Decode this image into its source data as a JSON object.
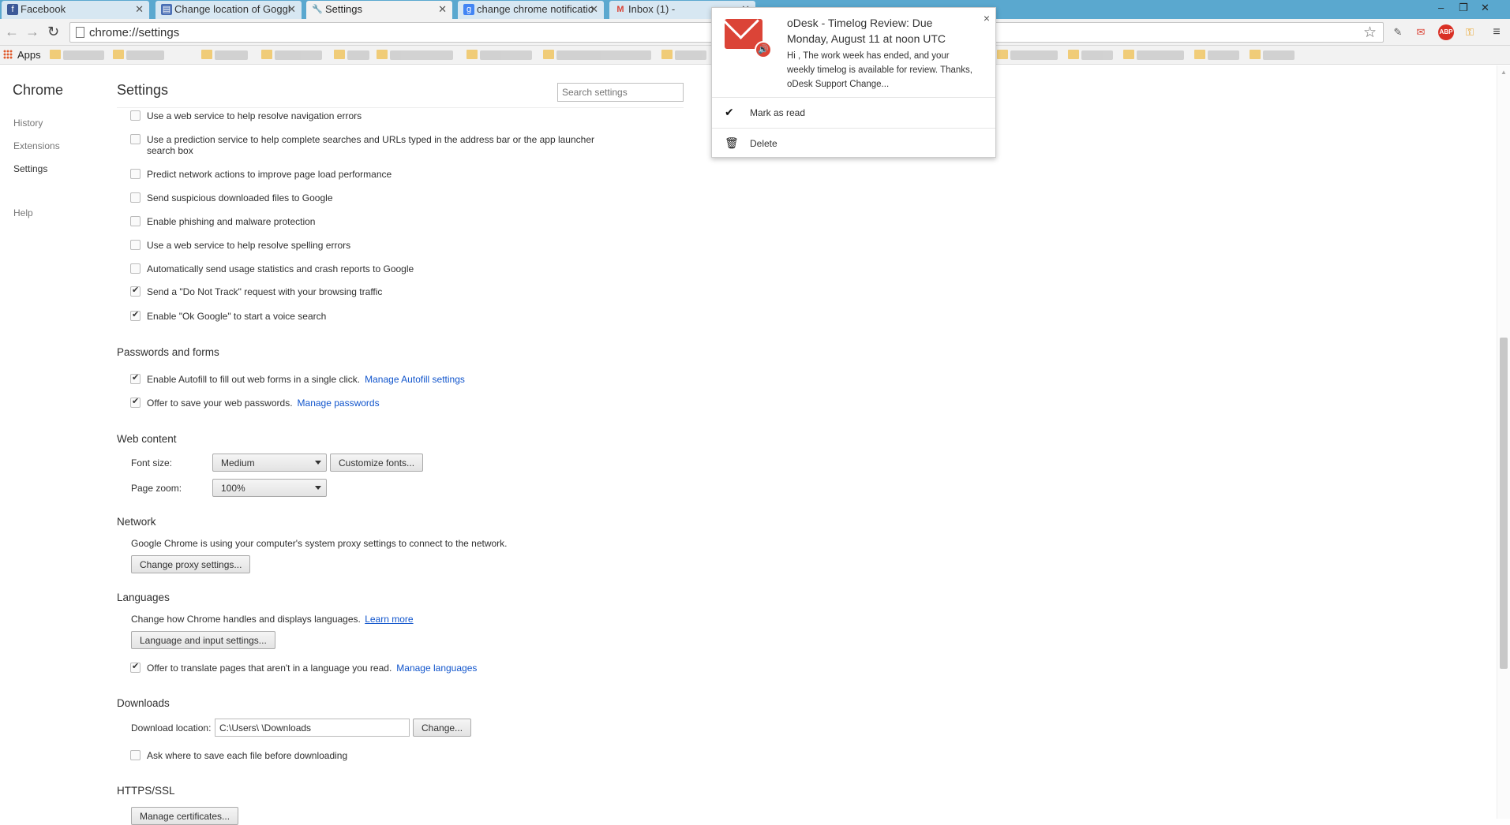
{
  "tabs": [
    {
      "label": "Facebook",
      "icon": "facebook-icon",
      "color": "#3b5998",
      "glyph": "f"
    },
    {
      "label": "Change location of Goggl",
      "icon": "document-icon",
      "color": "#4a6fb5",
      "glyph": "▤"
    },
    {
      "label": "Settings",
      "icon": "wrench-icon",
      "color": "#555555",
      "glyph": "🔧"
    },
    {
      "label": "change chrome notificatio",
      "icon": "google-icon",
      "color": "#4285f4",
      "glyph": "g"
    },
    {
      "label": "Inbox (1) -",
      "icon": "gmail-icon",
      "color": "#db4437",
      "glyph": "M"
    }
  ],
  "window_controls": [
    "–",
    "❐",
    "✕"
  ],
  "omnibox": {
    "url": "chrome://settings"
  },
  "bookmarks": {
    "apps_label": "Apps"
  },
  "sidebar": {
    "title": "Chrome",
    "items": [
      {
        "label": "History"
      },
      {
        "label": "Extensions"
      },
      {
        "label": "Settings"
      },
      {
        "label": "Help"
      }
    ]
  },
  "page": {
    "title": "Settings",
    "search_placeholder": "Search settings"
  },
  "privacy": [
    {
      "label": "Use a web service to help resolve navigation errors",
      "checked": false
    },
    {
      "label": "Use a prediction service to help complete searches and URLs typed in the address bar or the app launcher search box",
      "checked": false
    },
    {
      "label": "Predict network actions to improve page load performance",
      "checked": false
    },
    {
      "label": "Send suspicious downloaded files to Google",
      "checked": false
    },
    {
      "label": "Enable phishing and malware protection",
      "checked": false
    },
    {
      "label": "Use a web service to help resolve spelling errors",
      "checked": false
    },
    {
      "label": "Automatically send usage statistics and crash reports to Google",
      "checked": false
    },
    {
      "label": "Send a \"Do Not Track\" request with your browsing traffic",
      "checked": true
    },
    {
      "label": "Enable \"Ok Google\" to start a voice search",
      "checked": true
    }
  ],
  "passwords": {
    "title": "Passwords and forms",
    "autofill": {
      "label": "Enable Autofill to fill out web forms in a single click.",
      "link": "Manage Autofill settings",
      "checked": true
    },
    "save_pw": {
      "label": "Offer to save your web passwords.",
      "link": "Manage passwords",
      "checked": true
    }
  },
  "web_content": {
    "title": "Web content",
    "font_size_label": "Font size:",
    "font_size_value": "Medium",
    "customize_fonts": "Customize fonts...",
    "page_zoom_label": "Page zoom:",
    "page_zoom_value": "100%"
  },
  "network": {
    "title": "Network",
    "text": "Google Chrome is using your computer's system proxy settings to connect to the network.",
    "button": "Change proxy settings..."
  },
  "languages": {
    "title": "Languages",
    "text": "Change how Chrome handles and displays languages.",
    "learn_more": "Learn more",
    "button": "Language and input settings...",
    "translate": {
      "label": "Offer to translate pages that aren't in a language you read.",
      "link": "Manage languages",
      "checked": true
    }
  },
  "downloads": {
    "title": "Downloads",
    "location_label": "Download location:",
    "location_value": "C:\\Users\\            \\Downloads",
    "change": "Change...",
    "ask": {
      "label": "Ask where to save each file before downloading",
      "checked": false
    }
  },
  "https": {
    "title": "HTTPS/SSL",
    "button": "Manage certificates..."
  },
  "notification": {
    "title": "oDesk - Timelog Review: Due Monday, August 11 at noon UTC",
    "body": "Hi              , The work week has ended, and your weekly timelog is available for review. Thanks, oDesk Support Change...",
    "close": "×",
    "mark_read": "Mark as read",
    "delete": "Delete"
  }
}
